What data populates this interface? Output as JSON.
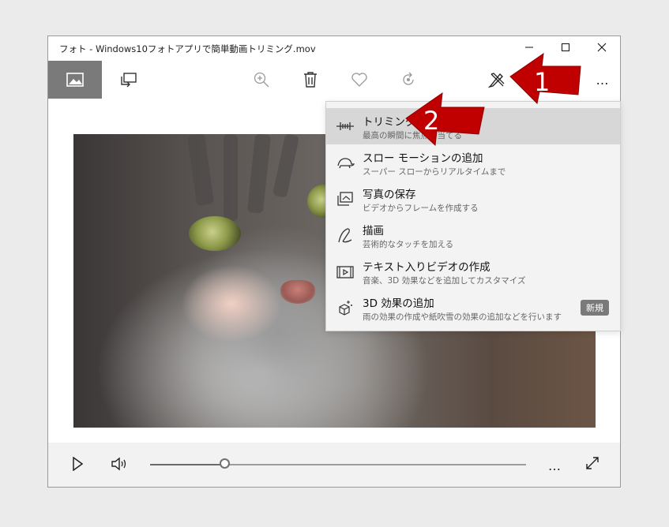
{
  "window": {
    "title": "フォト - Windows10フォトアプリで簡単動画トリミング.mov",
    "min_icon": "minimize-icon",
    "max_icon": "maximize-icon",
    "close_icon": "close-icon"
  },
  "toolbar": {
    "icons": [
      "picture-icon",
      "slideshow-icon",
      "zoom-icon",
      "delete-icon",
      "favorite-icon",
      "rotate-icon",
      "edit-create-icon"
    ],
    "more_label": "…"
  },
  "menu": {
    "items": [
      {
        "icon": "trim-icon",
        "title": "トリミング",
        "subtitle": "最高の瞬間に焦点を当てる"
      },
      {
        "icon": "slow-motion-icon",
        "title": "スロー モーションの追加",
        "subtitle": "スーパー スローからリアルタイムまで"
      },
      {
        "icon": "save-photo-icon",
        "title": "写真の保存",
        "subtitle": "ビデオからフレームを作成する"
      },
      {
        "icon": "draw-icon",
        "title": "描画",
        "subtitle": "芸術的なタッチを加える"
      },
      {
        "icon": "text-video-icon",
        "title": "テキスト入りビデオの作成",
        "subtitle": "音楽、3D 効果などを追加してカスタマイズ"
      },
      {
        "icon": "3d-effects-icon",
        "title": "3D 効果の追加",
        "subtitle": "雨の効果の作成や紙吹雪の効果の追加などを行います",
        "badge": "新規"
      }
    ]
  },
  "callouts": {
    "first": "1",
    "second": "2",
    "color": "#c00000"
  },
  "controls": {
    "play_icon": "play-icon",
    "volume_icon": "volume-icon",
    "progress": 0.2,
    "more_label": "…",
    "fullscreen_icon": "fullscreen-icon"
  },
  "colors": {
    "accent_active": "#7a7a7a",
    "menu_highlight": "#d7d7d7",
    "callout": "#c00000"
  }
}
